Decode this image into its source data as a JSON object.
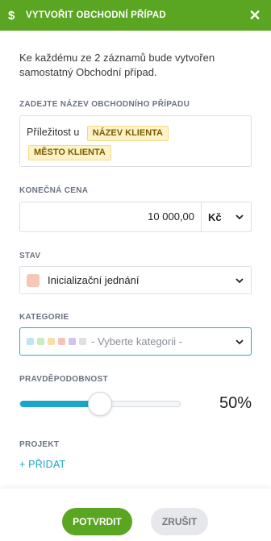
{
  "header": {
    "title": "VYTVOŘIT OBCHODNÍ PŘÍPAD",
    "dollar_glyph": "$",
    "close_glyph": "✕"
  },
  "intro_text": "Ke každému ze 2 záznamů bude vytvořen samostatný Obchodní případ.",
  "name_field": {
    "label": "ZADEJTE NÁZEV OBCHODNÍHO PŘÍPADU",
    "prefix": "Příležitost u",
    "tags": [
      "NÁZEV KLIENTA",
      "MĚSTO KLIENTA"
    ]
  },
  "price_field": {
    "label": "KONEČNÁ CENA",
    "value": "10 000,00",
    "currency": "Kč"
  },
  "status_field": {
    "label": "STAV",
    "value": "Inicializační jednání",
    "swatch_color": "#f6c7b6"
  },
  "category_field": {
    "label": "KATEGORIE",
    "placeholder": "- Vyberte kategorii -",
    "dot_colors": [
      "#bfe6f0",
      "#c9ecc0",
      "#f6e0a6",
      "#f5c4b8",
      "#d4c2f0",
      "#e0e0e0"
    ]
  },
  "probability_field": {
    "label": "PRAVDĚPODOBNOST",
    "value": 50,
    "display": "50%"
  },
  "project_field": {
    "label": "PROJEKT",
    "add_label": "+ PŘIDAT"
  },
  "buttons": {
    "confirm": "POTVRDIT",
    "cancel": "ZRUŠIT"
  },
  "colors": {
    "brand_green": "#5aa521",
    "accent_blue": "#1ba5c7"
  }
}
